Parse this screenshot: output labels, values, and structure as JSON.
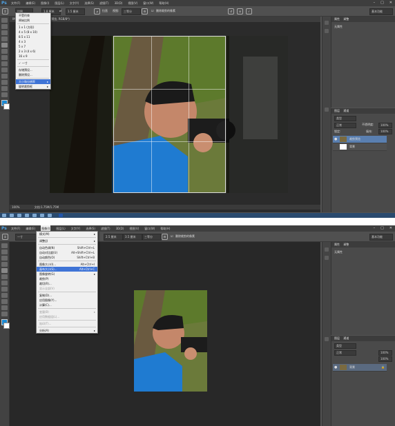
{
  "ps_logo": "Ps",
  "menu_labels": [
    "文件(F)",
    "编辑(E)",
    "图像(I)",
    "图层(L)",
    "文字(Y)",
    "选择(S)",
    "滤镜(T)",
    "3D(D)",
    "视图(V)",
    "窗口(W)",
    "帮助(H)"
  ],
  "window_controls": [
    "–",
    "□",
    "✕"
  ],
  "top": {
    "options": {
      "ratio": "比例",
      "w": "1.8 厘米",
      "h": "1.5 厘米",
      "straighten": "拉直",
      "view": "视图:",
      "view_val": "三等分",
      "delete": "删除裁剪的像素"
    },
    "doc_tab": "IMG_3719.jpg @ 100% (裁剪预览, RGB/8*)",
    "status_zoom": "100%",
    "status_doc": "文档:1.75M/1.75M",
    "workspace": "基本功能",
    "panel1_tabs": [
      "属性",
      "调整"
    ],
    "panel1_label": "无属性",
    "layers_tabs": [
      "图层",
      "通道"
    ],
    "layers_kind": "类型",
    "layers_mode": "正常",
    "layers_opacity_label": "不透明度:",
    "layers_opacity": "100%",
    "layers_lock": "锁定:",
    "layers_fill_label": "填充:",
    "layers_fill": "100%",
    "layers": [
      "裁剪预览",
      "背景"
    ],
    "ratio_menu": [
      {
        "label": "不受约束"
      },
      {
        "label": "原始比例"
      },
      {
        "sep": true
      },
      {
        "label": "1 x 1 (方形)"
      },
      {
        "label": "4 x 5 (8 x 10)"
      },
      {
        "label": "8.5 x 11"
      },
      {
        "label": "4 x 3"
      },
      {
        "label": "5 x 7"
      },
      {
        "label": "2 x 3 (4 x 6)"
      },
      {
        "label": "16 x 9"
      },
      {
        "sep": true
      },
      {
        "label": "✓ 一寸"
      },
      {
        "sep": true
      },
      {
        "label": "存储预设..."
      },
      {
        "label": "删除预设..."
      },
      {
        "sep": true
      },
      {
        "label": "大小和分辨率",
        "hl": true,
        "arr": "▸"
      },
      {
        "label": "旋转裁剪框",
        "arr": "▸"
      }
    ]
  },
  "bottom": {
    "options": {
      "ratio": "一寸",
      "w": "2.5 厘米",
      "h": "3.5 厘米",
      "straighten": "拉直",
      "view": "视图:",
      "view_val": "三等分",
      "delete": "删除裁剪的像素"
    },
    "workspace": "基本功能",
    "panel1_tabs": [
      "属性",
      "调整"
    ],
    "panel1_label": "无属性",
    "layers_tabs": [
      "图层",
      "通道"
    ],
    "layers_kind": "类型",
    "layers_mode": "正常",
    "layers_opacity": "100%",
    "layers_fill": "100%",
    "layer_name": "背景",
    "image_menu": [
      {
        "label": "模式(M)",
        "arr": "▸"
      },
      {
        "sep": true
      },
      {
        "label": "调整(J)",
        "arr": "▸"
      },
      {
        "sep": true
      },
      {
        "label": "自动色调(N)",
        "sc": "Shift+Ctrl+L"
      },
      {
        "label": "自动对比度(U)",
        "sc": "Alt+Shift+Ctrl+L"
      },
      {
        "label": "自动颜色(O)",
        "sc": "Shift+Ctrl+B"
      },
      {
        "sep": true
      },
      {
        "label": "图像大小(I)...",
        "sc": "Alt+Ctrl+I"
      },
      {
        "label": "画布大小(S)...",
        "sc": "Alt+Ctrl+C",
        "hl": true
      },
      {
        "label": "图像旋转(G)",
        "arr": "▸"
      },
      {
        "label": "裁剪(P)"
      },
      {
        "label": "裁切(R)..."
      },
      {
        "label": "显示全部(V)",
        "dis": true
      },
      {
        "sep": true
      },
      {
        "label": "复制(D)..."
      },
      {
        "label": "应用图像(Y)..."
      },
      {
        "label": "计算(C)..."
      },
      {
        "sep": true
      },
      {
        "label": "变量(B)",
        "arr": "▸",
        "dis": true
      },
      {
        "label": "应用数据组(L)...",
        "dis": true
      },
      {
        "sep": true
      },
      {
        "label": "陷印(T)...",
        "dis": true
      },
      {
        "sep": true
      },
      {
        "label": "分析(A)",
        "arr": "▸"
      }
    ]
  }
}
